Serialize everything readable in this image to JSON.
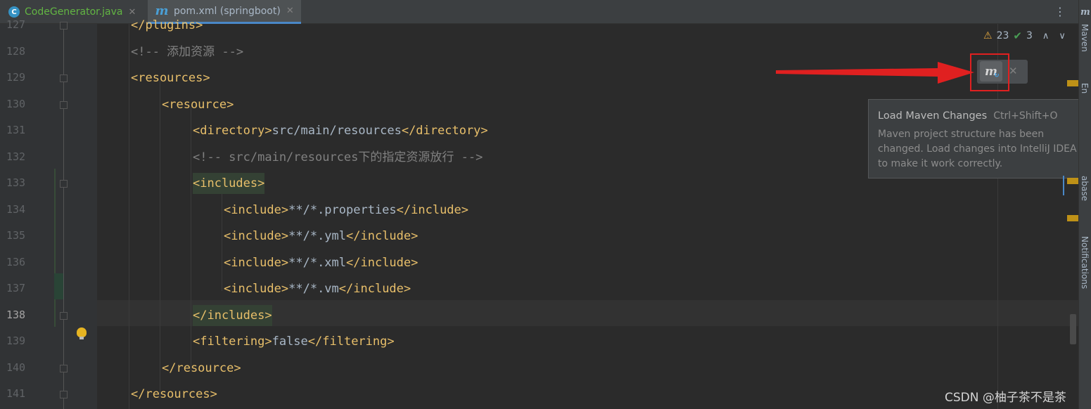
{
  "tabs": [
    {
      "label": "CodeGenerator.java",
      "icon": "class-icon",
      "icon_glyph": "C",
      "active": false
    },
    {
      "label": "pom.xml (springboot)",
      "icon": "maven-icon",
      "icon_glyph": "m",
      "active": true
    }
  ],
  "tab_close_glyph": "✕",
  "menu_glyph": "⋮",
  "line_numbers": [
    "127",
    "128",
    "129",
    "130",
    "131",
    "132",
    "133",
    "134",
    "135",
    "136",
    "137",
    "138",
    "139",
    "140",
    "141"
  ],
  "code_lines": [
    [
      {
        "c": "tag",
        "t": "</plugins>"
      }
    ],
    [
      {
        "c": "cmt",
        "t": "<!-- 添加资源 -->"
      }
    ],
    [
      {
        "c": "tag",
        "t": "<resources>"
      }
    ],
    [
      {
        "c": "tag",
        "t": "<resource>"
      }
    ],
    [
      {
        "c": "tag",
        "t": "<directory>"
      },
      {
        "c": "txt",
        "t": "src/main/resources"
      },
      {
        "c": "tag",
        "t": "</directory>"
      }
    ],
    [
      {
        "c": "cmt",
        "t": "<!-- src/main/resources下的指定资源放行 -->"
      }
    ],
    [
      {
        "c": "tag hl",
        "t": "<includes>"
      }
    ],
    [
      {
        "c": "tag",
        "t": "<include>"
      },
      {
        "c": "txt",
        "t": "**/*.properties"
      },
      {
        "c": "tag",
        "t": "</include>"
      }
    ],
    [
      {
        "c": "tag",
        "t": "<include>"
      },
      {
        "c": "txt",
        "t": "**/*.yml"
      },
      {
        "c": "tag",
        "t": "</include>"
      }
    ],
    [
      {
        "c": "tag",
        "t": "<include>"
      },
      {
        "c": "txt",
        "t": "**/*.xml"
      },
      {
        "c": "tag",
        "t": "</include>"
      }
    ],
    [
      {
        "c": "tag",
        "t": "<include>"
      },
      {
        "c": "txt",
        "t": "**/*.vm"
      },
      {
        "c": "tag",
        "t": "</include>"
      }
    ],
    [
      {
        "c": "tag hl",
        "t": "</includes>"
      }
    ],
    [
      {
        "c": "tag",
        "t": "<filtering>"
      },
      {
        "c": "txt",
        "t": "false"
      },
      {
        "c": "tag",
        "t": "</filtering>"
      }
    ],
    [
      {
        "c": "tag",
        "t": "</resource>"
      }
    ],
    [
      {
        "c": "tag",
        "t": "</resources>"
      }
    ]
  ],
  "current_line": "138",
  "inspections": {
    "warnings": "23",
    "weak_warnings": "3",
    "warning_icon": "⚠",
    "check_icon": "✔",
    "up_glyph": "∧",
    "down_glyph": "∨"
  },
  "maven_reload": {
    "icon": "maven-reload-icon",
    "glyph": "m",
    "refresh_glyph": "↻",
    "close_glyph": "✕"
  },
  "tooltip": {
    "title": "Load Maven Changes",
    "shortcut": "Ctrl+Shift+O",
    "description": "Maven project structure has been changed. Load changes into IntelliJ IDEA to make it work correctly."
  },
  "right_panels": {
    "maven": "Maven",
    "endpoints": "En",
    "database": "abase",
    "notifications": "Notifications"
  },
  "watermark": "CSDN @柚子茶不是茶",
  "colors": {
    "annotation_red": "#e02020",
    "tag": "#e8bf6a",
    "comment": "#808080"
  }
}
